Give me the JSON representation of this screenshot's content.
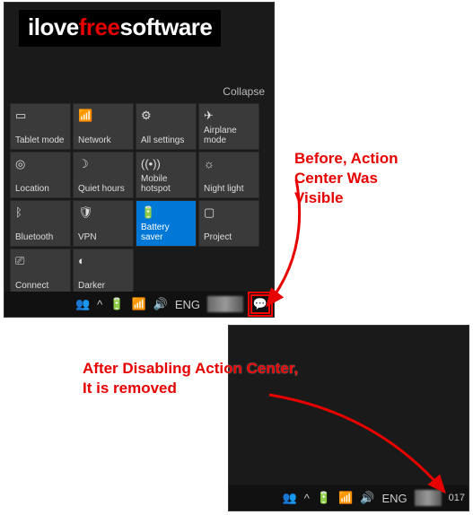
{
  "logo": {
    "part1": "ilove",
    "part2": "free",
    "part3": "software"
  },
  "collapse_label": "Collapse",
  "tiles": [
    {
      "label": "Tablet mode",
      "icon": "▭"
    },
    {
      "label": "Network",
      "icon": "📶"
    },
    {
      "label": "All settings",
      "icon": "⚙"
    },
    {
      "label": "Airplane mode",
      "icon": "✈"
    },
    {
      "label": "Location",
      "icon": "◎"
    },
    {
      "label": "Quiet hours",
      "icon": "☽"
    },
    {
      "label": "Mobile hotspot",
      "icon": "((•))"
    },
    {
      "label": "Night light",
      "icon": "☼"
    },
    {
      "label": "Bluetooth",
      "icon": "ᛒ"
    },
    {
      "label": "VPN",
      "icon": "🛡"
    },
    {
      "label": "Battery saver",
      "icon": "🔋",
      "accent": true
    },
    {
      "label": "Project",
      "icon": "▢"
    },
    {
      "label": "Connect",
      "icon": "⎚"
    },
    {
      "label": "Darker",
      "icon": "◐"
    }
  ],
  "taskbar": {
    "people": "👥",
    "chevron": "^",
    "battery": "🔋",
    "wifi": "📶",
    "volume": "🔊",
    "lang": "ENG",
    "year_fragment": "017",
    "action_center": "💬"
  },
  "annotations": {
    "before": "Before, Action\nCenter Was\nVisible",
    "after": "After Disabling Action Center,\nIt is removed"
  }
}
